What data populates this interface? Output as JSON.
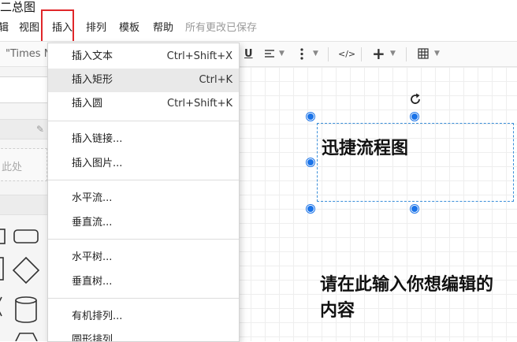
{
  "app": {
    "title": "二总图"
  },
  "menubar": {
    "items": [
      {
        "label": "辑"
      },
      {
        "label": "视图"
      },
      {
        "label": "插入"
      },
      {
        "label": "排列"
      },
      {
        "label": "模板"
      },
      {
        "label": "帮助"
      }
    ],
    "status": "所有更改已保存"
  },
  "toolbar": {
    "font_family": "\"Times N",
    "underline_icon": "U",
    "align_icon": "align-left-icon",
    "more_icon": "more-vertical-icon",
    "html_label": "</>",
    "add_icon": "+",
    "table_icon": "table-icon"
  },
  "sidebar": {
    "drop_hint": "此处"
  },
  "dropdown": {
    "items": [
      {
        "label": "插入文本",
        "shortcut": "Ctrl+Shift+X"
      },
      {
        "label": "插入矩形",
        "shortcut": "Ctrl+K"
      },
      {
        "label": "插入圆",
        "shortcut": "Ctrl+Shift+K"
      },
      {
        "label": "插入链接..."
      },
      {
        "label": "插入图片..."
      },
      {
        "label": "水平流..."
      },
      {
        "label": "垂直流..."
      },
      {
        "label": "水平树..."
      },
      {
        "label": "垂直树..."
      },
      {
        "label": "有机排列..."
      },
      {
        "label": "圆形排列..."
      }
    ]
  },
  "canvas": {
    "shape_title": "迅捷流程图",
    "body_text": "请在此输入你想编辑的内容"
  },
  "colors": {
    "accent": "#1a73e8",
    "highlight_border": "#e0272a",
    "selection_border": "#3b8fd9"
  }
}
